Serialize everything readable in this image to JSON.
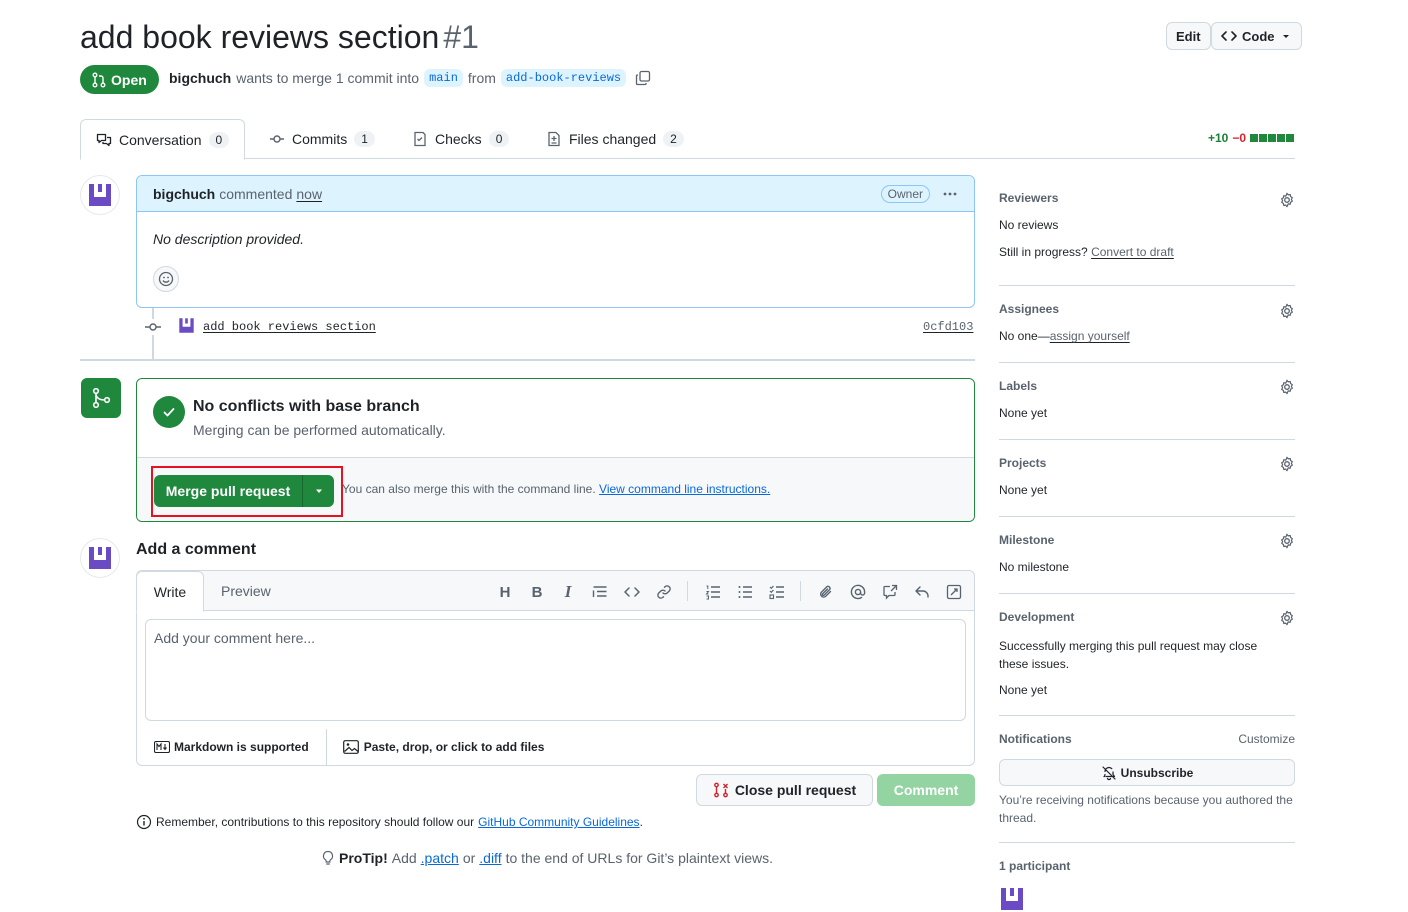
{
  "pr": {
    "title": "add book reviews section",
    "number": "#1",
    "state": "Open",
    "author": "bigchuch",
    "merge_text": "wants to merge 1 commit into",
    "base_branch": "main",
    "from_text": "from",
    "head_branch": "add-book-reviews"
  },
  "header_buttons": {
    "edit": "Edit",
    "code": "Code"
  },
  "tabs": [
    {
      "label": "Conversation",
      "count": "0"
    },
    {
      "label": "Commits",
      "count": "1"
    },
    {
      "label": "Checks",
      "count": "0"
    },
    {
      "label": "Files changed",
      "count": "2"
    }
  ],
  "diffstat": {
    "added": "+10",
    "removed": "−0"
  },
  "comment": {
    "author": "bigchuch",
    "action": "commented",
    "time": "now",
    "role": "Owner",
    "body": "No description provided."
  },
  "commit": {
    "message": "add book reviews section",
    "sha": "0cfd103"
  },
  "merge": {
    "title": "No conflicts with base branch",
    "subtitle": "Merging can be performed automatically.",
    "button": "Merge pull request",
    "hint": "You can also merge this with the command line.",
    "hint_link": "View command line instructions."
  },
  "add_comment": {
    "heading": "Add a comment",
    "tab_write": "Write",
    "tab_preview": "Preview",
    "placeholder": "Add your comment here...",
    "markdown": "Markdown is supported",
    "files": "Paste, drop, or click to add files",
    "close_button": "Close pull request",
    "comment_button": "Comment"
  },
  "guidelines": {
    "text": "Remember, contributions to this repository should follow our",
    "link": "GitHub Community Guidelines",
    "end": "."
  },
  "protip": {
    "label": "ProTip!",
    "pre": "Add",
    "patch": ".patch",
    "or": "or",
    "diff": ".diff",
    "post": "to the end of URLs for Git’s plaintext views."
  },
  "sidebar": {
    "reviewers": {
      "title": "Reviewers",
      "value": "No reviews",
      "progress": "Still in progress?",
      "progress_link": "Convert to draft"
    },
    "assignees": {
      "title": "Assignees",
      "value": "No one—",
      "link": "assign yourself"
    },
    "labels": {
      "title": "Labels",
      "value": "None yet"
    },
    "projects": {
      "title": "Projects",
      "value": "None yet"
    },
    "milestone": {
      "title": "Milestone",
      "value": "No milestone"
    },
    "development": {
      "title": "Development",
      "desc": "Successfully merging this pull request may close these issues.",
      "value": "None yet"
    },
    "notifications": {
      "title": "Notifications",
      "customize": "Customize",
      "button": "Unsubscribe",
      "desc": "You’re receiving notifications because you authored the thread."
    },
    "participants": {
      "title": "1 participant"
    }
  },
  "colors": {
    "open_green": "#1f883d",
    "link_blue": "#0969da",
    "highlight_red": "#e5121f",
    "avatar_purple": "#6a4bc4"
  }
}
